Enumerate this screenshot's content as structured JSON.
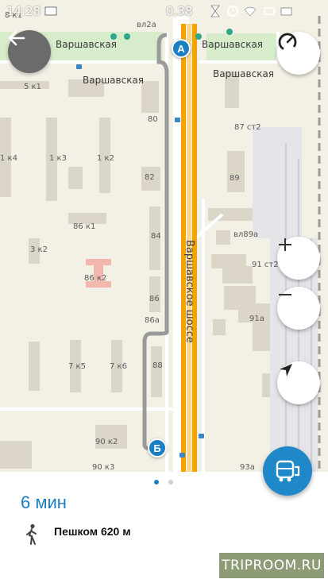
{
  "status_bar": {
    "time": "14:28",
    "battery": "0,38",
    "icons": [
      "mail-icon",
      "hourglass-icon",
      "alarm-icon",
      "wifi-icon",
      "battery-icon",
      "signal-icon"
    ]
  },
  "map": {
    "streets": {
      "varshavskaya_left": "Варшавская",
      "varshavskaya_left2": "Варшавская",
      "varshavskaya_right": "Варшавская",
      "varshavskaya_right2": "Варшавская",
      "highway": "Варшавское шоссе"
    },
    "buildings": {
      "b8k1": "8 к1",
      "bvl2a": "вл2а",
      "b5k1": "5 к1",
      "b80": "80",
      "b87st2": "87 ст2",
      "b1k4": "1 к4",
      "b1k3": "1 к3",
      "b1k2": "1 к2",
      "b82": "82",
      "b89": "89",
      "b86k1": "86 к1",
      "b84": "84",
      "bvl89a": "вл89а",
      "b3k2": "3 к2",
      "b91st2": "91 ст2",
      "b86k2": "86 к2",
      "b86": "86",
      "b86a": "86а",
      "b91a": "91а",
      "b7k5": "7 к5",
      "b7k6": "7 к6",
      "b88": "88",
      "b90k2": "90 к2",
      "b90k3": "90 к3",
      "b93a": "93а"
    },
    "markers": {
      "start": "А",
      "end": "Б"
    }
  },
  "route": {
    "duration": "6 мин",
    "mode_label": "Пешком 620 м",
    "page_count": 2,
    "active_page": 1
  },
  "watermark": "TRIPROOM.RU",
  "colors": {
    "accent": "#1e88c9",
    "highway": "#f5a300",
    "route": "#9a9a9a",
    "duration_text": "#1b7fc4"
  }
}
